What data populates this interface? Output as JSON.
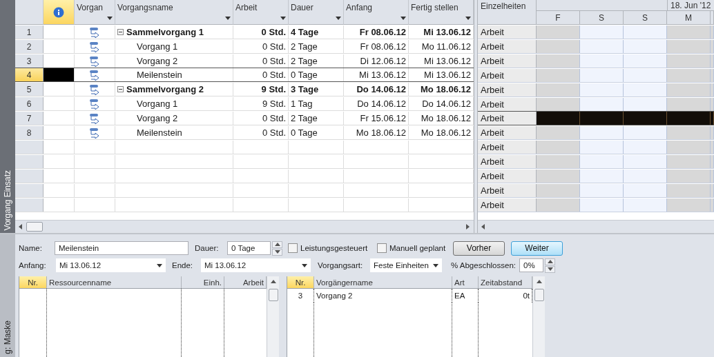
{
  "views": {
    "top_label": "Vorgang Einsatz",
    "bottom_label": "g: Maske"
  },
  "task_table": {
    "columns": [
      "Vorgan",
      "Vorgangsname",
      "Arbeit",
      "Dauer",
      "Anfang",
      "Fertig stellen"
    ],
    "tasks": [
      {
        "nr": "1",
        "name": "Sammelvorgang 1",
        "work": "0 Std.",
        "duration": "4 Tage",
        "start": "Fr 08.06.12",
        "finish": "Mi 13.06.12",
        "selected": false,
        "expanded": true,
        "children": [
          {
            "nr": "2",
            "name": "Vorgang 1",
            "work": "0 Std.",
            "duration": "2 Tage",
            "start": "Fr 08.06.12",
            "finish": "Mo 11.06.12",
            "selected": false
          },
          {
            "nr": "3",
            "name": "Vorgang 2",
            "work": "0 Std.",
            "duration": "2 Tage",
            "start": "Di 12.06.12",
            "finish": "Mi 13.06.12",
            "selected": false
          },
          {
            "nr": "4",
            "name": "Meilenstein",
            "work": "0 Std.",
            "duration": "0 Tage",
            "start": "Mi 13.06.12",
            "finish": "Mi 13.06.12",
            "selected": true
          }
        ]
      },
      {
        "nr": "5",
        "name": "Sammelvorgang 2",
        "work": "9 Std.",
        "duration": "3 Tage",
        "start": "Do 14.06.12",
        "finish": "Mo 18.06.12",
        "selected": false,
        "expanded": true,
        "children": [
          {
            "nr": "6",
            "name": "Vorgang 1",
            "work": "9 Std.",
            "duration": "1 Tag",
            "start": "Do 14.06.12",
            "finish": "Do 14.06.12",
            "selected": false
          },
          {
            "nr": "7",
            "name": "Vorgang 2",
            "work": "0 Std.",
            "duration": "2 Tage",
            "start": "Fr 15.06.12",
            "finish": "Mo 18.06.12",
            "selected": false
          },
          {
            "nr": "8",
            "name": "Meilenstein",
            "work": "0 Std.",
            "duration": "0 Tage",
            "start": "Mo 18.06.12",
            "finish": "Mo 18.06.12",
            "selected": false
          }
        ]
      }
    ]
  },
  "usage": {
    "details_header": "Einzelheiten",
    "timescale": "18. Jun '12",
    "days": [
      {
        "label": "F",
        "weekend": false
      },
      {
        "label": "S",
        "weekend": true
      },
      {
        "label": "S",
        "weekend": true
      },
      {
        "label": "M",
        "weekend": false
      }
    ],
    "rows": [
      {
        "label": "Arbeit",
        "selected": false
      },
      {
        "label": "Arbeit",
        "selected": false
      },
      {
        "label": "Arbeit",
        "selected": false
      },
      {
        "label": "Arbeit",
        "selected": false
      },
      {
        "label": "Arbeit",
        "selected": false
      },
      {
        "label": "Arbeit",
        "selected": false
      },
      {
        "label": "Arbeit",
        "selected": true
      },
      {
        "label": "Arbeit",
        "selected": false
      },
      {
        "label": "Arbeit",
        "selected": false
      },
      {
        "label": "Arbeit",
        "selected": false
      },
      {
        "label": "Arbeit",
        "selected": false
      },
      {
        "label": "Arbeit",
        "selected": false
      },
      {
        "label": "Arbeit",
        "selected": false
      }
    ]
  },
  "form": {
    "name": {
      "label": "Name:",
      "value": "Meilenstein"
    },
    "duration": {
      "label": "Dauer:",
      "value": "0 Tage"
    },
    "checkboxes": [
      {
        "label": "Leistungsgesteuert",
        "checked": false
      },
      {
        "label": "Manuell geplant",
        "checked": false
      }
    ],
    "buttons": [
      {
        "label": "Vorher",
        "default": false
      },
      {
        "label": "Weiter",
        "default": true
      }
    ],
    "start": {
      "label": "Anfang:",
      "value": "Mi 13.06.12"
    },
    "finish": {
      "label": "Ende:",
      "value": "Mi 13.06.12"
    },
    "task_type": {
      "label": "Vorgangsart:",
      "value": "Feste Einheiten"
    },
    "percent": {
      "label": "% Abgeschlossen:",
      "value": "0%"
    }
  },
  "resources": {
    "columns": [
      "Nr.",
      "Ressourcenname",
      "Einh.",
      "Arbeit"
    ]
  },
  "predecessors": {
    "columns": [
      "Nr.",
      "Vorgängername",
      "Art",
      "Zeitabstand"
    ],
    "rows": [
      {
        "nr": "3",
        "name": "Vorgang 2",
        "type": "EA",
        "lag": "0t"
      }
    ]
  }
}
